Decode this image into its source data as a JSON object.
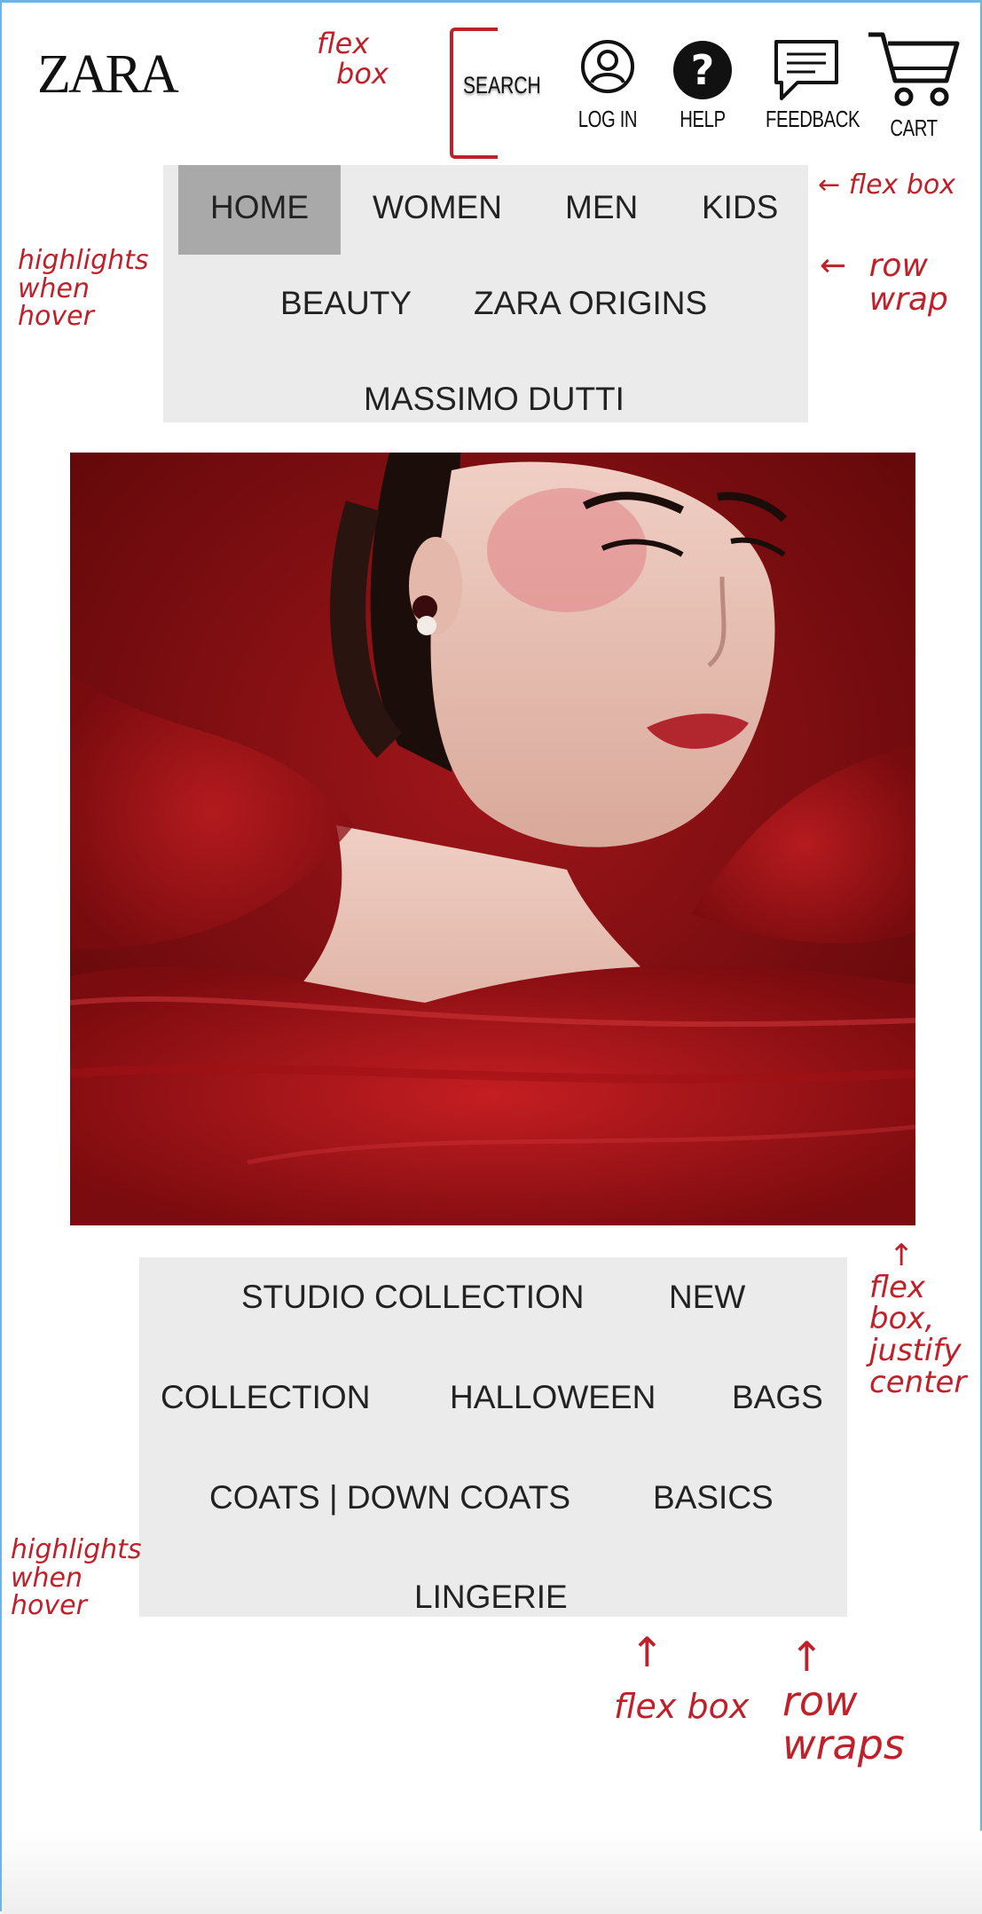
{
  "brand": {
    "logo": "ZARA"
  },
  "header": {
    "search_label": "SEARCH",
    "actions": [
      {
        "label": "LOG IN",
        "icon": "user-icon"
      },
      {
        "label": "HELP",
        "icon": "help-icon"
      },
      {
        "label": "FEEDBACK",
        "icon": "chat-icon"
      },
      {
        "label": "CART",
        "icon": "cart-icon"
      }
    ]
  },
  "main_nav": {
    "items": [
      "HOME",
      "WOMEN",
      "MEN",
      "KIDS",
      "BEAUTY",
      "ZARA ORIGINS",
      "MASSIMO DUTTI"
    ],
    "active": "HOME"
  },
  "hero": {
    "image": "model-in-red-tulle-photo"
  },
  "collection_nav": {
    "items": [
      "STUDIO COLLECTION",
      "NEW",
      "COLLECTION",
      "HALLOWEEN",
      "BAGS",
      "COATS | DOWN COATS",
      "BASICS",
      "LINGERIE"
    ]
  },
  "annotations": {
    "header_flex": [
      "flex",
      "box"
    ],
    "nav_flex": "flex box",
    "nav_wrap": [
      "row",
      "wrap"
    ],
    "nav_hover": [
      "highlights",
      "when",
      "hover"
    ],
    "hero_flex": [
      "flex",
      "box,",
      "justify",
      "center"
    ],
    "bottom_hover": [
      "highlights",
      "when",
      "hover"
    ],
    "bottom_flex": "flex box",
    "bottom_wrap": [
      "row",
      "wraps"
    ]
  },
  "colors": {
    "annotation": "#c0202a",
    "nav_bg": "#ebebeb",
    "active_bg": "#a9a9a9",
    "hero_red": "#8a0f12"
  }
}
